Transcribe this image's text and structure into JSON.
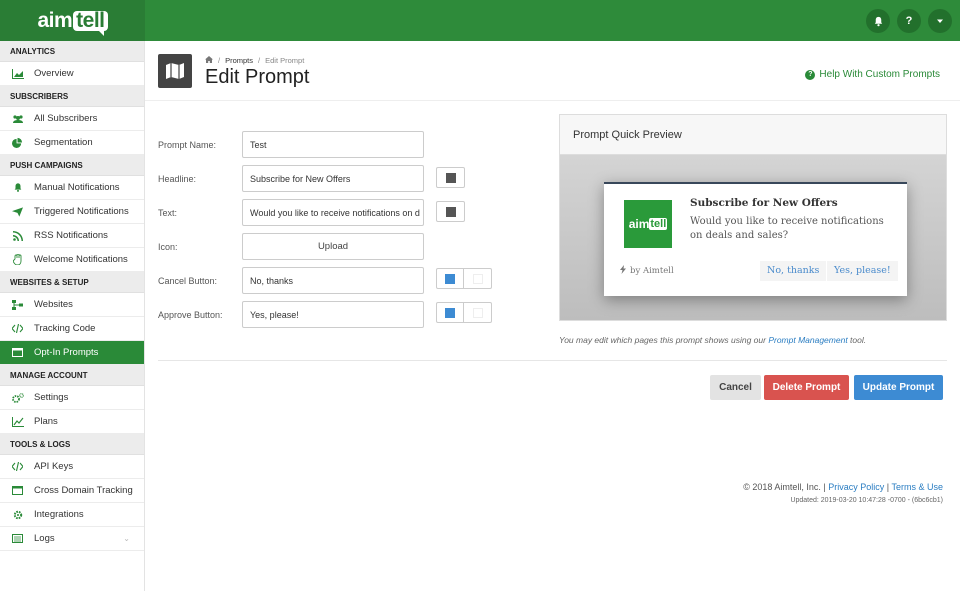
{
  "brand": {
    "name_prefix": "aim",
    "name_bubble": "tell"
  },
  "topbar": {
    "icons": [
      "bell-icon",
      "help-icon",
      "caret-down-icon"
    ]
  },
  "sidebar": {
    "sections": [
      {
        "title": "ANALYTICS",
        "items": [
          {
            "label": "Overview",
            "icon": "area-chart-icon"
          }
        ]
      },
      {
        "title": "SUBSCRIBERS",
        "items": [
          {
            "label": "All Subscribers",
            "icon": "users-icon"
          },
          {
            "label": "Segmentation",
            "icon": "pie-chart-icon"
          }
        ]
      },
      {
        "title": "PUSH CAMPAIGNS",
        "items": [
          {
            "label": "Manual Notifications",
            "icon": "bell-icon"
          },
          {
            "label": "Triggered Notifications",
            "icon": "send-icon"
          },
          {
            "label": "RSS Notifications",
            "icon": "rss-icon"
          },
          {
            "label": "Welcome Notifications",
            "icon": "hand-icon"
          }
        ]
      },
      {
        "title": "WEBSITES & SETUP",
        "items": [
          {
            "label": "Websites",
            "icon": "sitemap-icon"
          },
          {
            "label": "Tracking Code",
            "icon": "code-icon"
          },
          {
            "label": "Opt-In Prompts",
            "icon": "window-icon",
            "active": true
          }
        ]
      },
      {
        "title": "MANAGE ACCOUNT",
        "items": [
          {
            "label": "Settings",
            "icon": "cogs-icon"
          },
          {
            "label": "Plans",
            "icon": "line-chart-icon"
          }
        ]
      },
      {
        "title": "TOOLS & LOGS",
        "items": [
          {
            "label": "API Keys",
            "icon": "code-icon"
          },
          {
            "label": "Cross Domain Tracking",
            "icon": "window-icon"
          },
          {
            "label": "Integrations",
            "icon": "cog-icon"
          },
          {
            "label": "Logs",
            "icon": "list-icon"
          }
        ]
      }
    ]
  },
  "header": {
    "breadcrumb": {
      "home_icon": "home-icon",
      "parent": "Prompts",
      "current": "Edit Prompt"
    },
    "title": "Edit Prompt",
    "help_link": "Help With Custom Prompts"
  },
  "form": {
    "prompt_name": {
      "label": "Prompt Name:",
      "value": "Test"
    },
    "headline": {
      "label": "Headline:",
      "value": "Subscribe for New Offers",
      "color": "#555555"
    },
    "text": {
      "label": "Text:",
      "value": "Would you like to receive notifications on d",
      "color": "#555555"
    },
    "icon": {
      "label": "Icon:",
      "button": "Upload"
    },
    "cancel_button": {
      "label": "Cancel Button:",
      "value": "No, thanks",
      "bg_color": "#3d8bd3",
      "fg_color": "#ffffff"
    },
    "approve_button": {
      "label": "Approve Button:",
      "value": "Yes, please!",
      "bg_color": "#3d8bd3",
      "fg_color": "#ffffff"
    }
  },
  "preview": {
    "title": "Prompt Quick Preview",
    "headline": "Subscribe for New Offers",
    "text": "Would you like to receive notifications on deals and sales?",
    "by": "by Aimtell",
    "cancel": "No, thanks",
    "approve": "Yes, please!",
    "note_prefix": "You may edit which pages this prompt shows using our ",
    "note_link": "Prompt Management",
    "note_suffix": " tool."
  },
  "actions": {
    "cancel": "Cancel",
    "delete": "Delete Prompt",
    "update": "Update Prompt"
  },
  "footer": {
    "copyright": "© 2018 Aimtell, Inc. |",
    "privacy": "Privacy Policy",
    "sep": "|",
    "terms": "Terms & Use",
    "updated": "Updated: 2019-03-20 10:47:28 -0700 - (6bc6cb1)"
  },
  "colors": {
    "brand_green": "#2e8b3a",
    "active_green": "#2a8a38",
    "primary_blue": "#3d8bd3",
    "danger_red": "#d9534f"
  }
}
